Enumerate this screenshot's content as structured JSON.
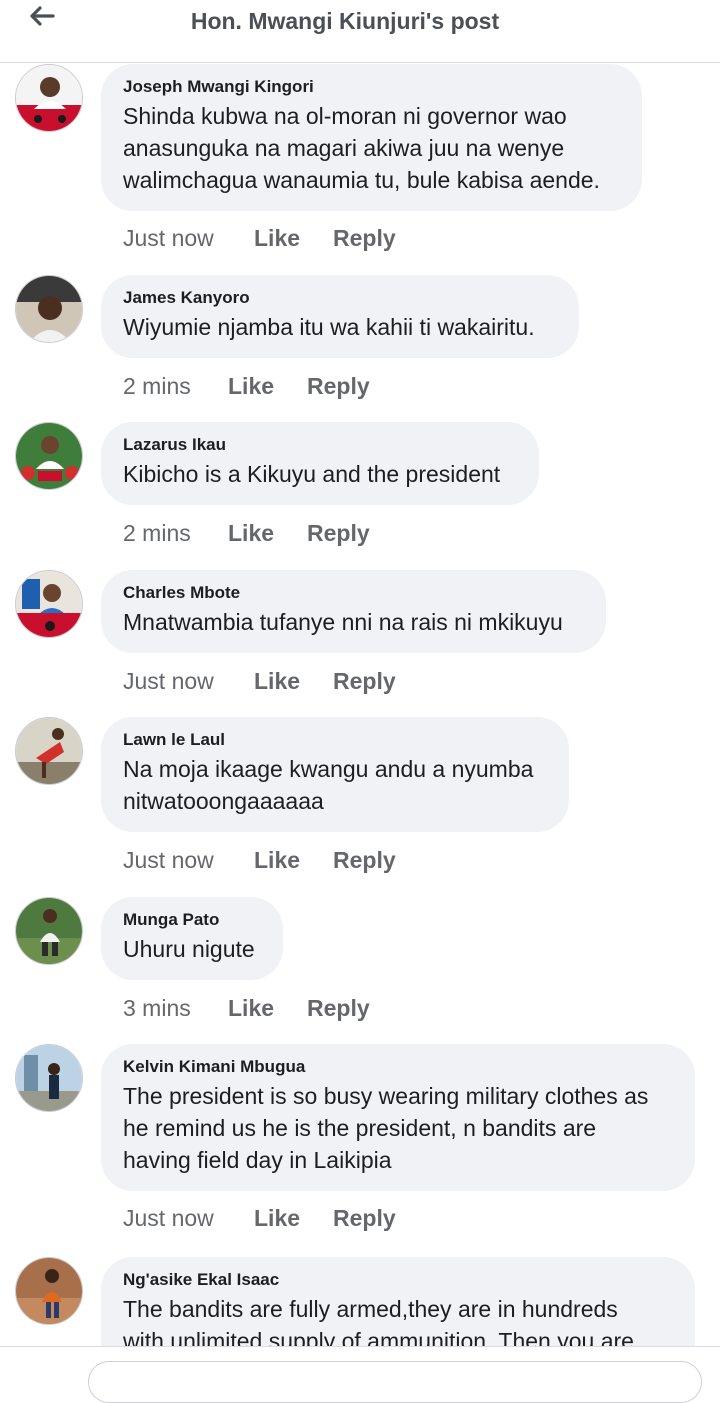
{
  "header": {
    "title": "Hon. Mwangi Kiunjuri's post",
    "back_icon": "arrow-left-icon"
  },
  "comments": [
    {
      "author": "Joseph Mwangi Kingori",
      "text": "Shinda kubwa na ol-moran ni governor wao\nanasunguka na magari akiwa juu na wenye\nwalimchagua wanaumia tu, bule kabisa aende.",
      "time": "Just now",
      "like": "Like",
      "reply": "Reply"
    },
    {
      "author": "James Kanyoro",
      "text": "Wiyumie njamba itu wa kahii ti wakairitu.",
      "time": "2 mins",
      "like": "Like",
      "reply": "Reply"
    },
    {
      "author": "Lazarus Ikau",
      "text": "Kibicho is a Kikuyu and the president",
      "time": "2 mins",
      "like": "Like",
      "reply": "Reply"
    },
    {
      "author": "Charles Mbote",
      "text": "Mnatwambia tufanye nni na rais ni mkikuyu",
      "time": "Just now",
      "like": "Like",
      "reply": "Reply"
    },
    {
      "author": "Lawn le Laul",
      "text": "Na moja ikaage kwangu andu a nyumba\nnitwatooongaaaaaa",
      "time": "Just now",
      "like": "Like",
      "reply": "Reply"
    },
    {
      "author": "Munga Pato",
      "text": "Uhuru nigute",
      "time": "3 mins",
      "like": "Like",
      "reply": "Reply"
    },
    {
      "author": "Kelvin Kimani Mbugua",
      "text": "The president is so busy wearing military clothes as\nhe remind us he is the president, n bandits are\nhaving field day in Laikipia",
      "time": "Just now",
      "like": "Like",
      "reply": "Reply"
    },
    {
      "author": "Ng'asike Ekal Isaac",
      "text": "The bandits are fully armed,they are in hundreds\nwith unlimited supply of ammunition.   Then you are",
      "time": "",
      "like": "",
      "reply": ""
    }
  ],
  "colors": {
    "bubble": "#f0f2f5",
    "meta_text": "#65676b",
    "title_text": "#4b4f56"
  }
}
